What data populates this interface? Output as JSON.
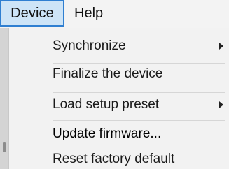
{
  "menubar": {
    "items": [
      {
        "label": "Device",
        "active": true
      },
      {
        "label": "Help",
        "active": false
      }
    ]
  },
  "dropdown": {
    "items": [
      {
        "label": "Synchronize",
        "submenu": true,
        "icon": "chevron-right-icon"
      },
      {
        "label": "Finalize the device",
        "submenu": false
      },
      {
        "label": "Load setup preset",
        "submenu": true,
        "icon": "chevron-right-icon"
      },
      {
        "label": "Update firmware...",
        "submenu": false
      },
      {
        "label": "Reset factory default",
        "submenu": false
      }
    ]
  },
  "colors": {
    "menu_highlight_bg": "#cde4f7",
    "menu_highlight_border": "#2f7fd1",
    "menu_bg": "#f2f2f2",
    "text": "#1a1a1a"
  }
}
